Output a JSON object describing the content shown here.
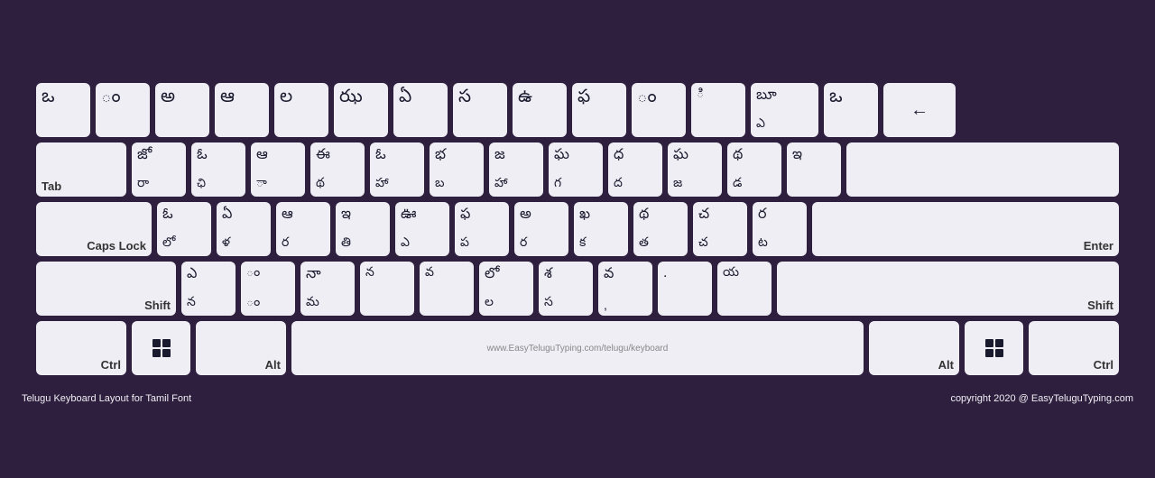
{
  "keyboard": {
    "title": "Telugu Keyboard Layout for Tamil Font",
    "copyright": "copyright 2020 @ EasyTeluguTyping.com",
    "website": "www.EasyTeluguTyping.com/telugu/keyboard",
    "rows": [
      {
        "id": "row1",
        "keys": [
          {
            "id": "tilde",
            "top": "ఒ",
            "bottom": "",
            "label": ""
          },
          {
            "id": "1",
            "top": "ం",
            "bottom": "",
            "label": ""
          },
          {
            "id": "2",
            "top": "అ",
            "bottom": "",
            "label": ""
          },
          {
            "id": "3",
            "top": "ఆ",
            "bottom": "",
            "label": ""
          },
          {
            "id": "4",
            "top": "ల",
            "bottom": "",
            "label": ""
          },
          {
            "id": "5",
            "top": "ఝ",
            "bottom": "",
            "label": ""
          },
          {
            "id": "6",
            "top": "ఏ",
            "bottom": "",
            "label": ""
          },
          {
            "id": "7",
            "top": "స",
            "bottom": "",
            "label": ""
          },
          {
            "id": "8",
            "top": "ఉ",
            "bottom": "",
            "label": ""
          },
          {
            "id": "9",
            "top": "ఫ",
            "bottom": "",
            "label": ""
          },
          {
            "id": "10",
            "top": "ం",
            "bottom": "",
            "label": ""
          },
          {
            "id": "11",
            "top": "ి",
            "bottom": "",
            "label": ""
          },
          {
            "id": "12",
            "top": "బూ",
            "bottom": "ఎ",
            "label": ""
          },
          {
            "id": "13",
            "top": "ఒ",
            "bottom": "",
            "label": ""
          },
          {
            "id": "backspace",
            "top": "←",
            "bottom": "",
            "label": ""
          }
        ]
      },
      {
        "id": "row2",
        "keys": [
          {
            "id": "tab",
            "top": "",
            "bottom": "",
            "label": "Tab"
          },
          {
            "id": "q",
            "top": "జో",
            "bottom": "రా",
            "label": ""
          },
          {
            "id": "w",
            "top": "ఓ",
            "bottom": "ఛి",
            "label": ""
          },
          {
            "id": "e",
            "top": "ఆ",
            "bottom": "ా",
            "label": ""
          },
          {
            "id": "r",
            "top": "ఈ",
            "bottom": "థ",
            "label": ""
          },
          {
            "id": "t",
            "top": "ఓ",
            "bottom": "హా",
            "label": ""
          },
          {
            "id": "y",
            "top": "భ",
            "bottom": "బ",
            "label": ""
          },
          {
            "id": "u",
            "top": "జ",
            "bottom": "హా",
            "label": ""
          },
          {
            "id": "i",
            "top": "ఘ",
            "bottom": "గ",
            "label": ""
          },
          {
            "id": "o",
            "top": "ధ",
            "bottom": "ద",
            "label": ""
          },
          {
            "id": "p",
            "top": "ఘ",
            "bottom": "జ",
            "label": ""
          },
          {
            "id": "bracket_l",
            "top": "థ",
            "bottom": "డ",
            "label": ""
          },
          {
            "id": "bracket_r",
            "top": "ఇ",
            "bottom": "",
            "label": ""
          },
          {
            "id": "backslash",
            "top": "",
            "bottom": "",
            "label": ""
          }
        ]
      },
      {
        "id": "row3",
        "keys": [
          {
            "id": "capslock",
            "top": "",
            "bottom": "",
            "label": "Caps Lock"
          },
          {
            "id": "a",
            "top": "ఓ",
            "bottom": "లో",
            "label": ""
          },
          {
            "id": "s",
            "top": "ఏ",
            "bottom": "ళ",
            "label": ""
          },
          {
            "id": "d",
            "top": "ఆ",
            "bottom": "ర",
            "label": ""
          },
          {
            "id": "f",
            "top": "ఇ",
            "bottom": "తి",
            "label": ""
          },
          {
            "id": "g",
            "top": "ఊ",
            "bottom": "ఎ",
            "label": ""
          },
          {
            "id": "h",
            "top": "ఫ",
            "bottom": "ప",
            "label": ""
          },
          {
            "id": "j",
            "top": "అ",
            "bottom": "ర",
            "label": ""
          },
          {
            "id": "k",
            "top": "ఖ",
            "bottom": "క",
            "label": ""
          },
          {
            "id": "l",
            "top": "థ",
            "bottom": "త",
            "label": ""
          },
          {
            "id": "semi",
            "top": "చ",
            "bottom": "చ",
            "label": ""
          },
          {
            "id": "quote",
            "top": "ర",
            "bottom": "ట",
            "label": ""
          },
          {
            "id": "enter",
            "top": "",
            "bottom": "",
            "label": "Enter"
          }
        ]
      },
      {
        "id": "row4",
        "keys": [
          {
            "id": "shift_l",
            "top": "",
            "bottom": "",
            "label": "Shift"
          },
          {
            "id": "z",
            "top": "ఎ",
            "bottom": "న",
            "label": ""
          },
          {
            "id": "x",
            "top": "ం",
            "bottom": "ం",
            "label": ""
          },
          {
            "id": "c",
            "top": "నా",
            "bottom": "మ",
            "label": ""
          },
          {
            "id": "v",
            "top": "",
            "bottom": "న",
            "label": ""
          },
          {
            "id": "b",
            "top": "",
            "bottom": "వ",
            "label": ""
          },
          {
            "id": "n",
            "top": "లో",
            "bottom": "ల",
            "label": ""
          },
          {
            "id": "m",
            "top": "శ",
            "bottom": "స",
            "label": ""
          },
          {
            "id": "comma",
            "top": "వ",
            "bottom": ",",
            "label": ""
          },
          {
            "id": "period",
            "top": "",
            "bottom": ".",
            "label": ""
          },
          {
            "id": "slash",
            "top": "",
            "bottom": "య",
            "label": ""
          },
          {
            "id": "shift_r",
            "top": "",
            "bottom": "",
            "label": "Shift"
          }
        ]
      },
      {
        "id": "row5",
        "keys": [
          {
            "id": "ctrl_l",
            "top": "",
            "bottom": "",
            "label": "Ctrl"
          },
          {
            "id": "win_l",
            "top": "",
            "bottom": "",
            "label": "win"
          },
          {
            "id": "alt_l",
            "top": "",
            "bottom": "",
            "label": "Alt"
          },
          {
            "id": "space",
            "top": "",
            "bottom": "",
            "label": "www.EasyTeluguTyping.com/telugu/keyboard"
          },
          {
            "id": "alt_r",
            "top": "",
            "bottom": "",
            "label": "Alt"
          },
          {
            "id": "win_r",
            "top": "",
            "bottom": "",
            "label": "win"
          },
          {
            "id": "ctrl_r",
            "top": "",
            "bottom": "",
            "label": "Ctrl"
          }
        ]
      }
    ]
  }
}
